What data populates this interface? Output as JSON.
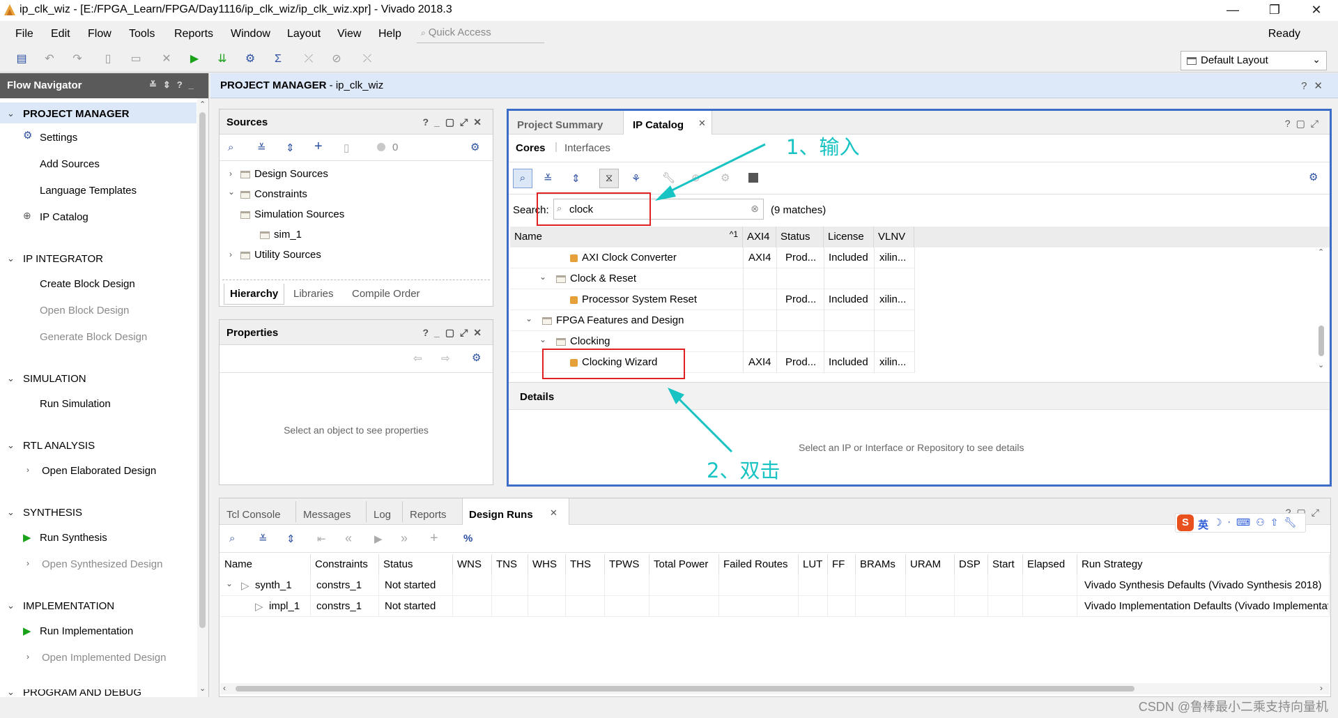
{
  "window": {
    "title": "ip_clk_wiz - [E:/FPGA_Learn/FPGA/Day1116/ip_clk_wiz/ip_clk_wiz.xpr] - Vivado 2018.3",
    "minimize": "—",
    "restore": "❐",
    "close": "✕"
  },
  "menu": {
    "items": [
      "File",
      "Edit",
      "Flow",
      "Tools",
      "Reports",
      "Window",
      "Layout",
      "View",
      "Help"
    ],
    "quick_access_placeholder": "Quick Access",
    "status": "Ready"
  },
  "toolbar": {
    "layout_select": "Default Layout"
  },
  "flow_navigator": {
    "title": "Flow Navigator",
    "sections": {
      "project_manager": {
        "label": "PROJECT MANAGER",
        "items": [
          "Settings",
          "Add Sources",
          "Language Templates",
          "IP Catalog"
        ]
      },
      "ip_integrator": {
        "label": "IP INTEGRATOR",
        "items": [
          "Create Block Design",
          "Open Block Design",
          "Generate Block Design"
        ]
      },
      "simulation": {
        "label": "SIMULATION",
        "items": [
          "Run Simulation"
        ]
      },
      "rtl_analysis": {
        "label": "RTL ANALYSIS",
        "items": [
          "Open Elaborated Design"
        ]
      },
      "synthesis": {
        "label": "SYNTHESIS",
        "items": [
          "Run Synthesis",
          "Open Synthesized Design"
        ]
      },
      "implementation": {
        "label": "IMPLEMENTATION",
        "items": [
          "Run Implementation",
          "Open Implemented Design"
        ]
      },
      "program_debug": {
        "label": "PROGRAM AND DEBUG"
      }
    }
  },
  "project_header": {
    "prefix": "PROJECT MANAGER",
    "name": " - ip_clk_wiz"
  },
  "sources": {
    "title": "Sources",
    "count": "0",
    "tree": [
      "Design Sources",
      "Constraints",
      "Simulation Sources",
      "sim_1",
      "Utility Sources"
    ],
    "tabs": [
      "Hierarchy",
      "Libraries",
      "Compile Order"
    ]
  },
  "properties": {
    "title": "Properties",
    "empty": "Select an object to see properties"
  },
  "ip_catalog": {
    "tabs": [
      "Project Summary",
      "IP Catalog"
    ],
    "subtabs": [
      "Cores",
      "Interfaces"
    ],
    "search_label": "Search:",
    "search_value": "clock",
    "matches": "(9 matches)",
    "columns": [
      "Name",
      "AXI4",
      "Status",
      "License",
      "VLNV"
    ],
    "sort_indicator": "^1",
    "rows": [
      {
        "name": "AXI Clock Converter",
        "axi4": "AXI4",
        "status": "Prod...",
        "license": "Included",
        "vlnv": "xilin..."
      },
      {
        "name": "Clock & Reset",
        "axi4": "",
        "status": "",
        "license": "",
        "vlnv": ""
      },
      {
        "name": "Processor System Reset",
        "axi4": "",
        "status": "Prod...",
        "license": "Included",
        "vlnv": "xilin..."
      },
      {
        "name": "FPGA Features and Design",
        "axi4": "",
        "status": "",
        "license": "",
        "vlnv": ""
      },
      {
        "name": "Clocking",
        "axi4": "",
        "status": "",
        "license": "",
        "vlnv": ""
      },
      {
        "name": "Clocking Wizard",
        "axi4": "AXI4",
        "status": "Prod...",
        "license": "Included",
        "vlnv": "xilin..."
      }
    ],
    "details_title": "Details",
    "details_empty": "Select an IP or Interface or Repository to see details"
  },
  "annotations": {
    "step1": "1、输入",
    "step2": "2、双击"
  },
  "bottom": {
    "tabs": [
      "Tcl Console",
      "Messages",
      "Log",
      "Reports",
      "Design Runs"
    ],
    "columns": [
      "Name",
      "Constraints",
      "Status",
      "WNS",
      "TNS",
      "WHS",
      "THS",
      "TPWS",
      "Total Power",
      "Failed Routes",
      "LUT",
      "FF",
      "BRAMs",
      "URAM",
      "DSP",
      "Start",
      "Elapsed",
      "Run Strategy"
    ],
    "runs": [
      {
        "name": "synth_1",
        "constraints": "constrs_1",
        "status": "Not started",
        "strategy": "Vivado Synthesis Defaults (Vivado Synthesis 2018)"
      },
      {
        "name": "impl_1",
        "constraints": "constrs_1",
        "status": "Not started",
        "strategy": "Vivado Implementation Defaults (Vivado Implementatio"
      }
    ]
  },
  "ime": {
    "label": "英"
  },
  "watermark": "CSDN @鲁棒最小二乘支持向量机",
  "colors": {
    "accent": "#3b6dc8",
    "highlight": "#e02020",
    "annotation": "#17c3c3",
    "run_green": "#1aa31a"
  }
}
